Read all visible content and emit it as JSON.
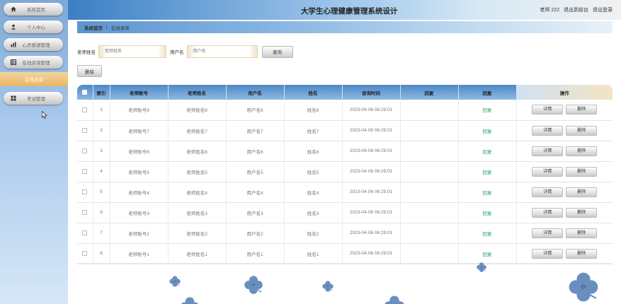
{
  "app": {
    "title": "大学生心理健康管理系统设计"
  },
  "header": {
    "user_label": "老师 222",
    "back_label": "退出到前台",
    "logout_label": "退出登录"
  },
  "sidebar": {
    "items": [
      {
        "label": "系统首页",
        "icon": "home-icon"
      },
      {
        "label": "个人中心",
        "icon": "person-icon"
      },
      {
        "label": "心灵感语管理",
        "icon": "chart-icon"
      },
      {
        "label": "在线咨询管理",
        "icon": "grid-icon"
      },
      {
        "label": "在线咨询",
        "active": true
      },
      {
        "label": "考试管理",
        "icon": "apps-icon"
      }
    ]
  },
  "breadcrumb": {
    "home": "系统首页",
    "separator": "|",
    "current": "在线咨询"
  },
  "search": {
    "teacher_name_label": "老师姓名",
    "teacher_name_placeholder": "老师姓名",
    "username_label": "用户名",
    "username_placeholder": "用户名",
    "search_button": "查询"
  },
  "toolbar": {
    "delete_label": "删除"
  },
  "table": {
    "headers": [
      "索引",
      "老师账号",
      "老师姓名",
      "用户名",
      "姓名",
      "咨询时间",
      "回复",
      "回复",
      "操作"
    ],
    "rows": [
      {
        "index": "1",
        "teacher_account": "老师账号8",
        "teacher_name": "老师姓名8",
        "username": "用户名8",
        "name": "姓名8",
        "time": "2023-04-06 06:29:01",
        "reply_text": "",
        "reply_action": "回复",
        "detail": "详情",
        "delete": "删除"
      },
      {
        "index": "2",
        "teacher_account": "老师账号7",
        "teacher_name": "老师姓名7",
        "username": "用户名7",
        "name": "姓名7",
        "time": "2023-04-06 06:29:01",
        "reply_text": "",
        "reply_action": "回复",
        "detail": "详情",
        "delete": "删除"
      },
      {
        "index": "3",
        "teacher_account": "老师账号6",
        "teacher_name": "老师姓名6",
        "username": "用户名6",
        "name": "姓名6",
        "time": "2023-04-06 06:29:01",
        "reply_text": "",
        "reply_action": "回复",
        "detail": "详情",
        "delete": "删除"
      },
      {
        "index": "4",
        "teacher_account": "老师账号5",
        "teacher_name": "老师姓名5",
        "username": "用户名5",
        "name": "姓名5",
        "time": "2023-04-06 06:29:01",
        "reply_text": "",
        "reply_action": "回复",
        "detail": "详情",
        "delete": "删除"
      },
      {
        "index": "5",
        "teacher_account": "老师账号4",
        "teacher_name": "老师姓名4",
        "username": "用户名4",
        "name": "姓名4",
        "time": "2023-04-06 06:29:01",
        "reply_text": "",
        "reply_action": "回复",
        "detail": "详情",
        "delete": "删除"
      },
      {
        "index": "6",
        "teacher_account": "老师账号3",
        "teacher_name": "老师姓名3",
        "username": "用户名3",
        "name": "姓名3",
        "time": "2023-04-06 06:29:01",
        "reply_text": "",
        "reply_action": "回复",
        "detail": "详情",
        "delete": "删除"
      },
      {
        "index": "7",
        "teacher_account": "老师账号2",
        "teacher_name": "老师姓名2",
        "username": "用户名2",
        "name": "姓名2",
        "time": "2023-04-06 06:29:01",
        "reply_text": "",
        "reply_action": "回复",
        "detail": "详情",
        "delete": "删除"
      },
      {
        "index": "8",
        "teacher_account": "老师账号1",
        "teacher_name": "老师姓名1",
        "username": "用户名1",
        "name": "姓名1",
        "time": "2023-04-06 06:29:01",
        "reply_text": "",
        "reply_action": "回复",
        "detail": "详情",
        "delete": "删除"
      }
    ]
  },
  "colors": {
    "accent_blue": "#4d88c8",
    "active_menu": "#e9b665",
    "reply_green": "#2aa05a",
    "flower_blue": "#6a8fbf"
  }
}
